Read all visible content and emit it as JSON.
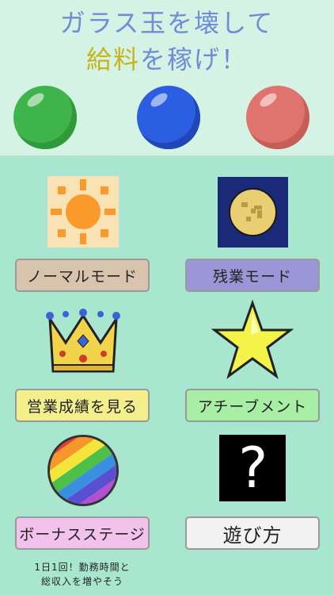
{
  "header": {
    "title_line1": "ガラス玉を壊して",
    "title_line2_accent": "給料",
    "title_line2_rest": "を稼げ！"
  },
  "balls": [
    {
      "name": "green",
      "color": "#3fb44a"
    },
    {
      "name": "blue",
      "color": "#2b5ee0"
    },
    {
      "name": "red",
      "color": "#e0736e"
    }
  ],
  "menu": {
    "normal_mode": "ノーマルモード",
    "overtime_mode": "残業モード",
    "results": "営業成績を見る",
    "achievements": "アチーブメント",
    "bonus_stage": "ボーナスステージ",
    "how_to_play": "遊び方"
  },
  "colors": {
    "normal_btn": "#d8c4ad",
    "overtime_btn": "#9b97d6",
    "results_btn": "#f4ee8c",
    "achievements_btn": "#a8eea5",
    "bonus_btn": "#f3c2ec",
    "howto_btn": "#f2f2f2"
  },
  "icons": {
    "sun": "sun-icon",
    "moon": "moon-icon",
    "crown": "crown-icon",
    "star": "star-icon",
    "rainbow": "rainbow-ball-icon",
    "question": "question-icon",
    "question_glyph": "?"
  },
  "footer": {
    "line1": "1日1回！勤務時間と",
    "line2": "総収入を増やそう"
  }
}
